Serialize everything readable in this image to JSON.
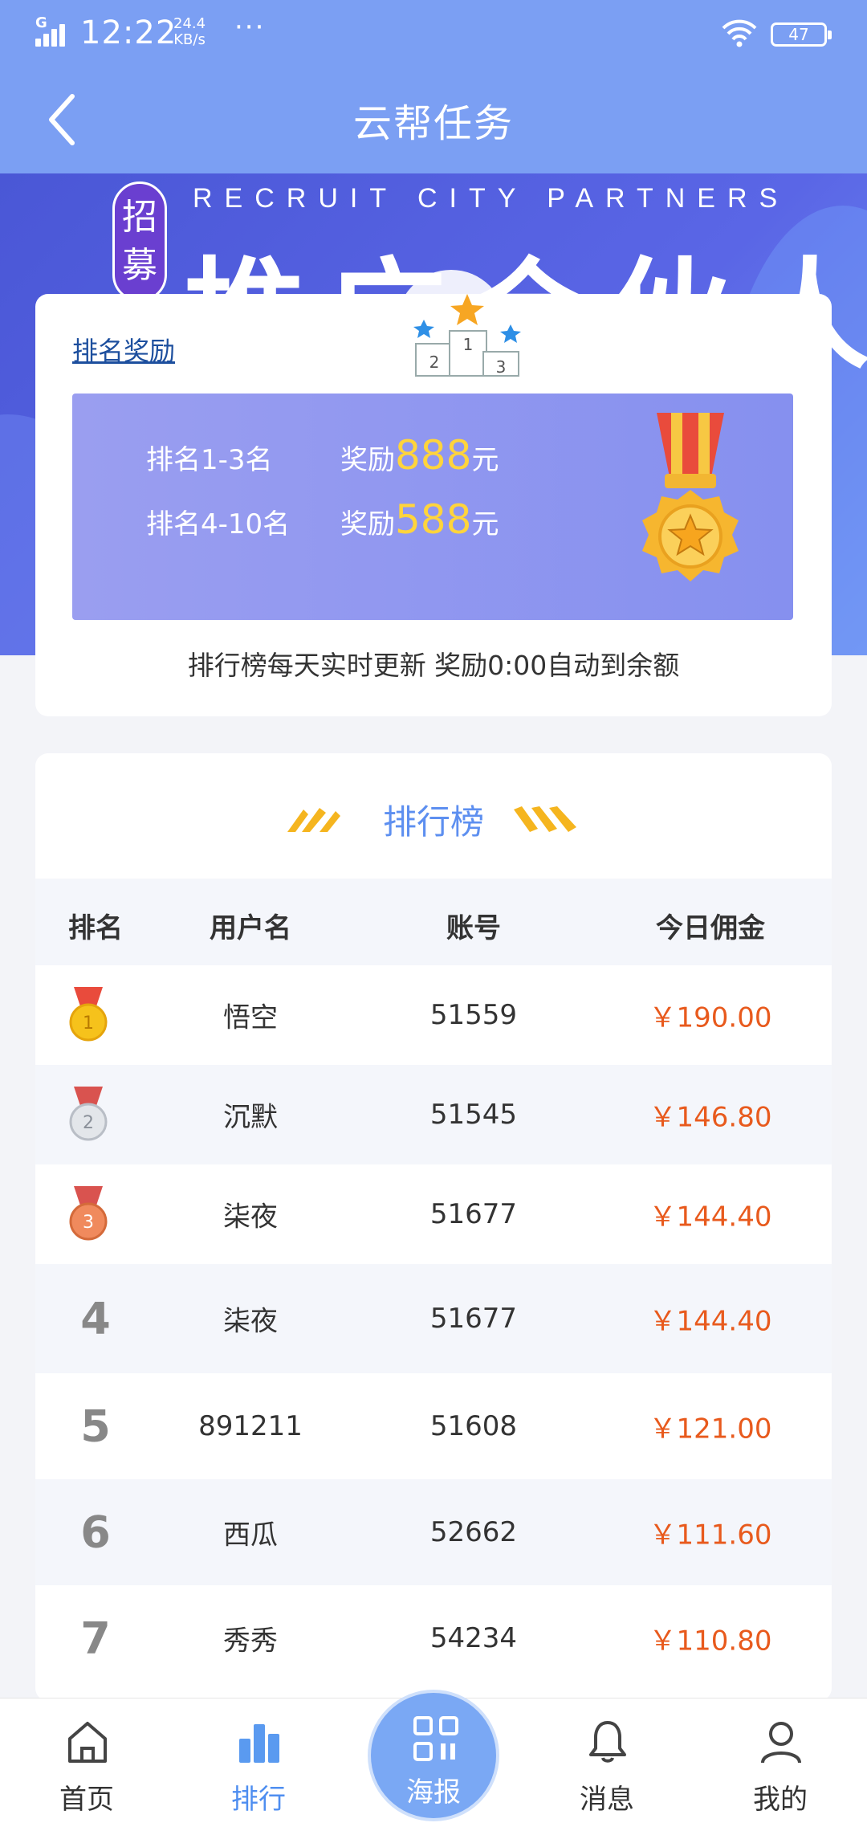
{
  "status_bar": {
    "signal_label": "G",
    "time": "12:22",
    "speed_value": "24.4",
    "speed_unit": "KB/s",
    "dots": "···",
    "battery": "47"
  },
  "header": {
    "title": "云帮任务"
  },
  "banner": {
    "english": "RECRUIT CITY PARTNERS",
    "tag": "招募",
    "headline": "推广合伙人"
  },
  "reward": {
    "link": "排名奖励",
    "podium": [
      "2",
      "1",
      "3"
    ],
    "rows": [
      {
        "rank": "排名1-3名",
        "prefix": "奖励",
        "amount": "888",
        "unit": "元"
      },
      {
        "rank": "排名4-10名",
        "prefix": "奖励",
        "amount": "588",
        "unit": "元"
      }
    ],
    "note": "排行榜每天实时更新 奖励0:00自动到余额"
  },
  "leaderboard": {
    "title": "排行榜",
    "columns": [
      "排名",
      "用户名",
      "账号",
      "今日佣金"
    ],
    "rows": [
      {
        "rank": "1",
        "name": "悟空",
        "account": "51559",
        "commission": "￥190.00"
      },
      {
        "rank": "2",
        "name": "沉默",
        "account": "51545",
        "commission": "￥146.80"
      },
      {
        "rank": "3",
        "name": "柒夜",
        "account": "51677",
        "commission": "￥144.40"
      },
      {
        "rank": "4",
        "name": "柒夜",
        "account": "51677",
        "commission": "￥144.40"
      },
      {
        "rank": "5",
        "name": "891211",
        "account": "51608",
        "commission": "￥121.00"
      },
      {
        "rank": "6",
        "name": "西瓜",
        "account": "52662",
        "commission": "￥111.60"
      },
      {
        "rank": "7",
        "name": "秀秀",
        "account": "54234",
        "commission": "￥110.80"
      }
    ]
  },
  "bottom_nav": {
    "items": [
      {
        "label": "首页",
        "icon": "home-icon"
      },
      {
        "label": "排行",
        "icon": "chart-icon",
        "active": true
      },
      {
        "label": "海报",
        "icon": "qr-icon"
      },
      {
        "label": "消息",
        "icon": "bell-icon"
      },
      {
        "label": "我的",
        "icon": "user-icon"
      }
    ]
  },
  "colors": {
    "header_bg": "#7b9ff3",
    "accent_blue": "#4e8ef0",
    "money_orange": "#e85a1d",
    "reward_gold": "#ffd43c"
  }
}
